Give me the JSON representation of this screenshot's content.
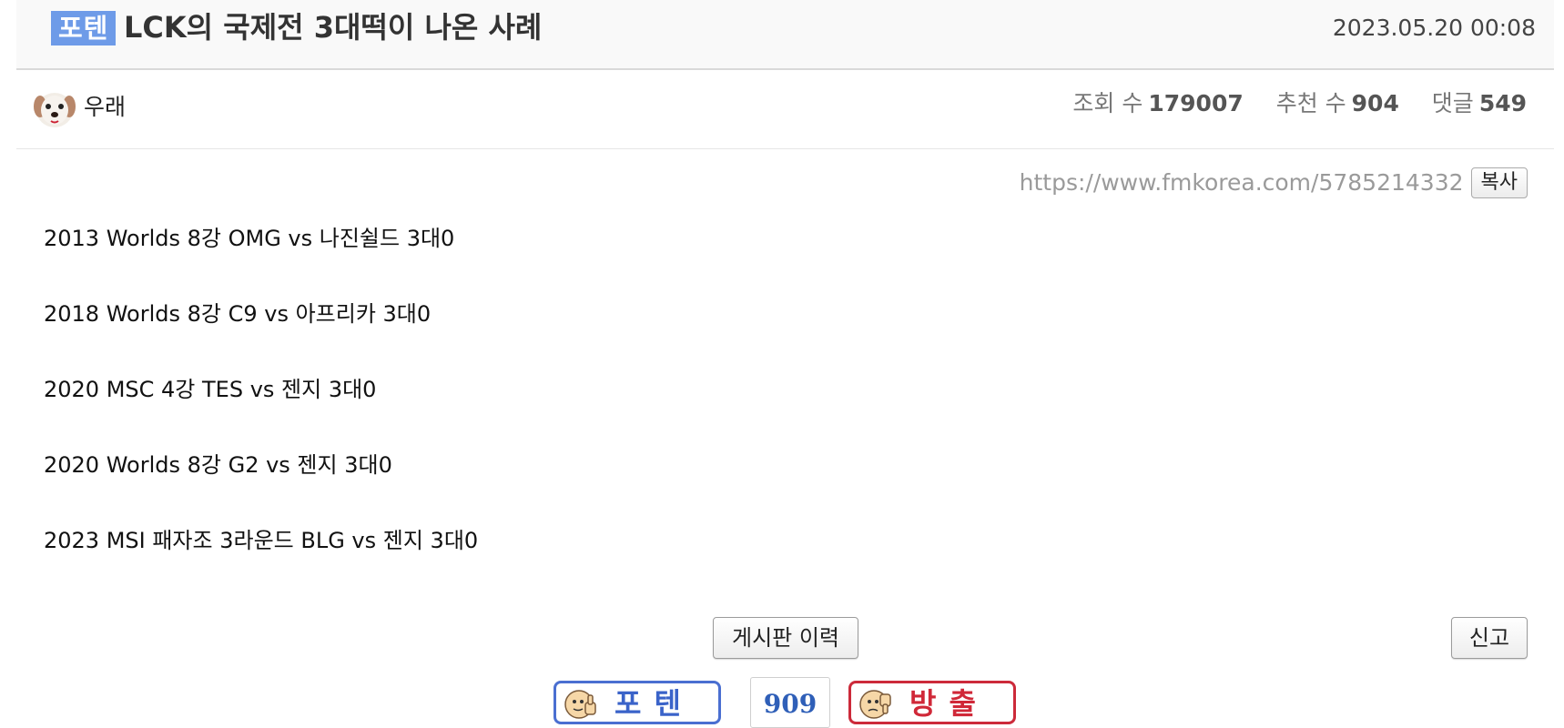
{
  "post": {
    "category_badge": "포텐",
    "title": "LCK의 국제전 3대떡이 나온 사례",
    "date": "2023.05.20 00:08",
    "author": "우래",
    "stats": [
      {
        "label": "조회 수",
        "value": "179007"
      },
      {
        "label": "추천 수",
        "value": "904"
      },
      {
        "label": "댓글",
        "value": "549"
      }
    ],
    "url": "https://www.fmkorea.com/5785214332",
    "copy_label": "복사",
    "content": [
      "2013 Worlds 8강 OMG vs 나진쉴드 3대0",
      "2018 Worlds 8강 C9 vs 아프리카 3대0",
      "2020 MSC 4강 TES vs 젠지 3대0",
      "2020 Worlds 8강 G2 vs 젠지 3대0",
      "2023 MSI 패자조 3라운드 BLG vs 젠지 3대0"
    ]
  },
  "actions": {
    "board_history_label": "게시판 이력",
    "report_label": "신고"
  },
  "vote": {
    "up_label": "포텐",
    "count": "909",
    "down_label": "방출",
    "up_icon": "thumbs-up-face-icon",
    "down_icon": "thumbs-down-face-icon"
  },
  "colors": {
    "badge": "#6e9be8",
    "vote_up": "#3a63c9",
    "vote_down": "#d02838"
  }
}
